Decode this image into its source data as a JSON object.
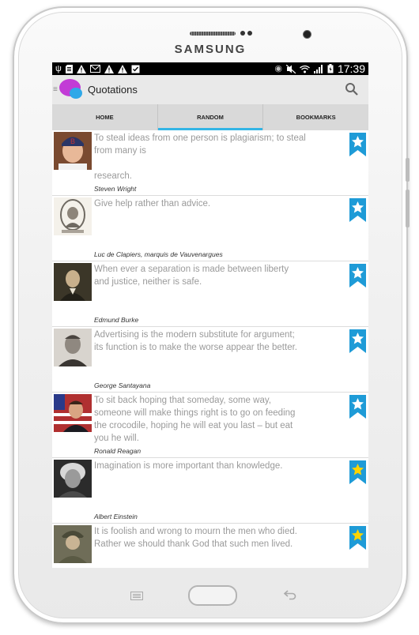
{
  "device": {
    "brand": "SAMSUNG"
  },
  "status_bar": {
    "time": "17:39",
    "left_icons": [
      "usb-icon",
      "sd-card-icon",
      "warning-icon",
      "gmail-icon",
      "warning-icon",
      "warning-icon",
      "clipboard-check-icon"
    ],
    "right_icons": [
      "eye-icon",
      "mute-icon",
      "wifi-icon",
      "signal-icon",
      "battery-icon"
    ]
  },
  "app_bar": {
    "title": "Quotations"
  },
  "tabs": [
    {
      "label": "HOME"
    },
    {
      "label": "RANDOM"
    },
    {
      "label": "BOOKMARKS"
    }
  ],
  "active_tab": "RANDOM",
  "colors": {
    "accent": "#33b5e5",
    "bookmark": "#1e9bd7",
    "star_default": "#ffffff",
    "star_bookmarked": "#ffd400"
  },
  "quotes": [
    {
      "text_line1": "To steal ideas from one person is plagiarism; to steal from many is",
      "text_line2": "research.",
      "author": "Steven Wright",
      "bookmarked": false
    },
    {
      "text": "Give help rather than advice.",
      "author": "Luc de Clapiers, marquis de Vauvenargues",
      "bookmarked": false
    },
    {
      "text": "When ever a separation is made between liberty and justice, neither is safe.",
      "author": "Edmund Burke",
      "bookmarked": false
    },
    {
      "text": "Advertising is the modern substitute for argument; its function is to make the worse appear the better.",
      "author": "George Santayana",
      "bookmarked": false
    },
    {
      "text": "To sit back hoping that someday, some way, someone will make things right is to go on feeding the crocodile, hoping he will eat you last –  but eat you he will.",
      "author": "Ronald Reagan",
      "bookmarked": false
    },
    {
      "text": "Imagination is more important than knowledge.",
      "author": "Albert Einstein",
      "bookmarked": true
    },
    {
      "text": "It is foolish and wrong to mourn the men who died. Rather we should thank God that such men lived.",
      "author": "",
      "bookmarked": true
    }
  ]
}
